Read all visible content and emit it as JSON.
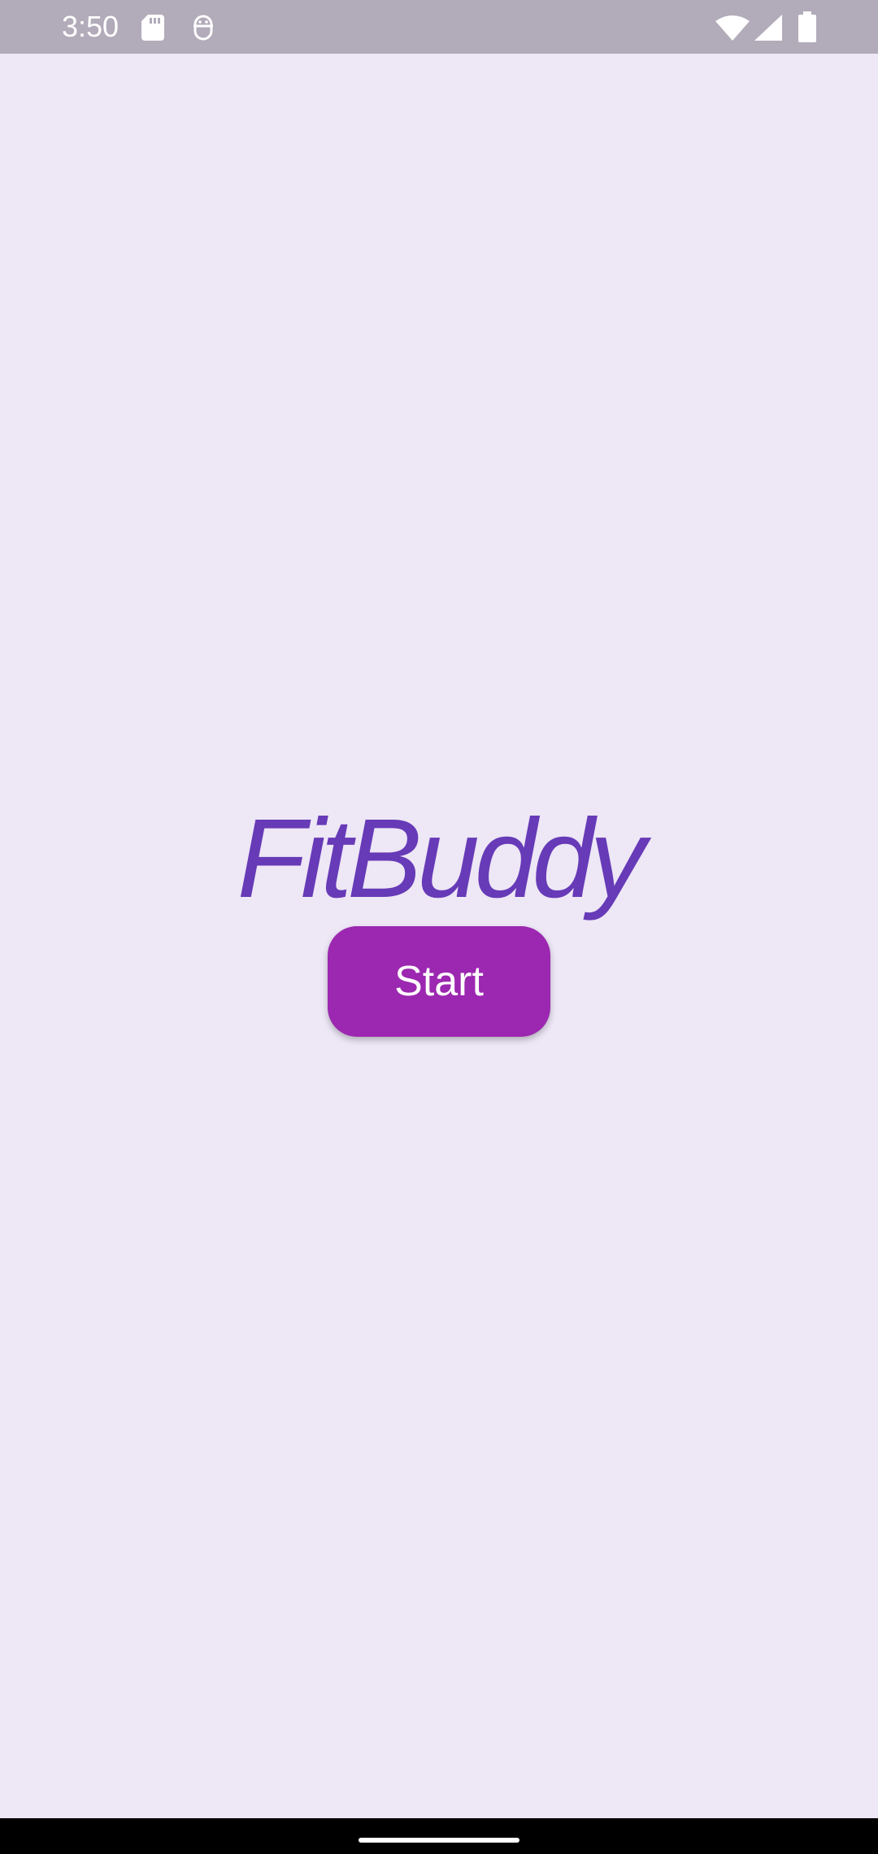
{
  "status_bar": {
    "time": "3:50",
    "icons": [
      "sd-card-icon",
      "face-icon",
      "wifi-icon",
      "signal-icon",
      "battery-icon"
    ]
  },
  "main": {
    "app_title": "FitBuddy",
    "start_label": "Start"
  },
  "colors": {
    "background": "#ede7f6",
    "status_bar": "#b2abb9",
    "title": "#673ab7",
    "button": "#9c27b0",
    "button_text": "#ffffff",
    "nav_bar": "#000000"
  }
}
